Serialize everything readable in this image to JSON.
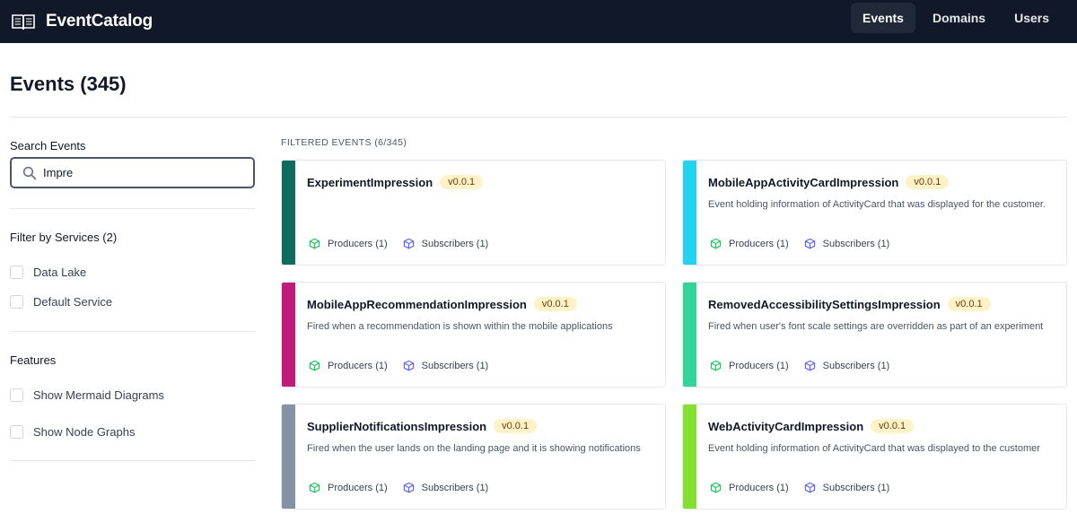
{
  "app": {
    "name": "EventCatalog"
  },
  "nav": [
    {
      "label": "Events",
      "active": true
    },
    {
      "label": "Domains",
      "active": false
    },
    {
      "label": "Users",
      "active": false
    }
  ],
  "page": {
    "title": "Events (345)"
  },
  "sidebar": {
    "search_label": "Search Events",
    "search_value": "Impre",
    "services_title": "Filter by Services (2)",
    "services": [
      "Data Lake",
      "Default Service"
    ],
    "features_title": "Features",
    "features": [
      "Show Mermaid Diagrams",
      "Show Node Graphs"
    ]
  },
  "main": {
    "filtered_label": "FILTERED EVENTS (6/345)",
    "events": [
      {
        "name": "ExperimentImpression",
        "version": "v0.0.1",
        "description": "",
        "producers": "Producers (1)",
        "subscribers": "Subscribers (1)",
        "color": "#0f6b5c"
      },
      {
        "name": "MobileAppActivityCardImpression",
        "version": "v0.0.1",
        "description": "Event holding information of ActivityCard that was displayed for the customer.",
        "producers": "Producers (1)",
        "subscribers": "Subscribers (1)",
        "color": "#22d3ee"
      },
      {
        "name": "MobileAppRecommendationImpression",
        "version": "v0.0.1",
        "description": "Fired when a recommendation is shown within the mobile applications",
        "producers": "Producers (1)",
        "subscribers": "Subscribers (1)",
        "color": "#be1b7a"
      },
      {
        "name": "RemovedAccessibilitySettingsImpression",
        "version": "v0.0.1",
        "description": "Fired when user's font scale settings are overridden as part of an experiment",
        "producers": "Producers (1)",
        "subscribers": "Subscribers (1)",
        "color": "#34d399"
      },
      {
        "name": "SupplierNotificationsImpression",
        "version": "v0.0.1",
        "description": "Fired when the user lands on the landing page and it is showing notifications",
        "producers": "Producers (1)",
        "subscribers": "Subscribers (1)",
        "color": "#8592a3"
      },
      {
        "name": "WebActivityCardImpression",
        "version": "v0.0.1",
        "description": "Event holding information of ActivityCard that was displayed to the customer",
        "producers": "Producers (1)",
        "subscribers": "Subscribers (1)",
        "color": "#84e12f"
      }
    ]
  },
  "icons": {
    "logo": "book-icon",
    "search": "search-icon",
    "producers": "cube-icon",
    "subscribers": "cube-icon"
  },
  "colors": {
    "topbar": "#111827",
    "badge_bg": "#fef3c7",
    "producer_icon": "#22c55e",
    "subscriber_icon": "#6366f1"
  }
}
